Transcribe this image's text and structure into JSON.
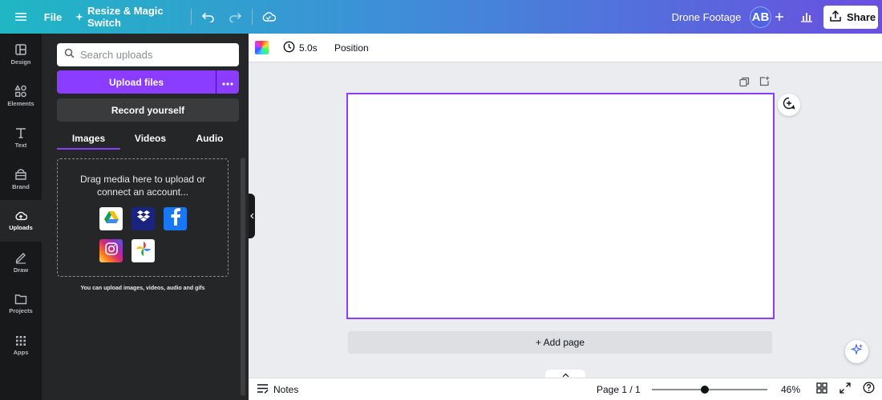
{
  "topbar": {
    "file_label": "File",
    "resize_label": "Resize & Magic Switch",
    "design_title": "Drone Footage",
    "avatar_initials": "AB",
    "share_label": "Share",
    "icons": [
      "menu-icon",
      "sparkle-icon",
      "undo-icon",
      "redo-icon",
      "cloud-save-icon",
      "plus-icon",
      "analytics-icon",
      "share-upload-icon"
    ]
  },
  "rail": {
    "items": [
      {
        "label": "Design",
        "icon": "design-icon"
      },
      {
        "label": "Elements",
        "icon": "elements-icon"
      },
      {
        "label": "Text",
        "icon": "text-icon"
      },
      {
        "label": "Brand",
        "icon": "brand-icon"
      },
      {
        "label": "Uploads",
        "icon": "uploads-icon",
        "active": true
      },
      {
        "label": "Draw",
        "icon": "draw-icon"
      },
      {
        "label": "Projects",
        "icon": "projects-icon"
      },
      {
        "label": "Apps",
        "icon": "apps-icon"
      }
    ]
  },
  "panel": {
    "search_placeholder": "Search uploads",
    "upload_label": "Upload files",
    "record_label": "Record yourself",
    "tabs": [
      {
        "label": "Images",
        "active": true
      },
      {
        "label": "Videos"
      },
      {
        "label": "Audio"
      }
    ],
    "drop_line1": "Drag media here to upload or",
    "drop_line2": "connect an account...",
    "services": [
      "google-drive-icon",
      "dropbox-icon",
      "facebook-icon",
      "instagram-icon",
      "google-photos-icon"
    ],
    "hint": "You can upload images, videos, audio and gifs"
  },
  "toolbar": {
    "duration": "5.0s",
    "position_label": "Position"
  },
  "canvas": {
    "add_page_label": "+ Add page"
  },
  "bottombar": {
    "notes_label": "Notes",
    "page_info": "Page 1 / 1",
    "zoom": "46%",
    "zoom_level": 0.46
  },
  "colors": {
    "accent": "#8b3dff",
    "rail_bg": "#18191b",
    "panel_bg": "#252627"
  }
}
